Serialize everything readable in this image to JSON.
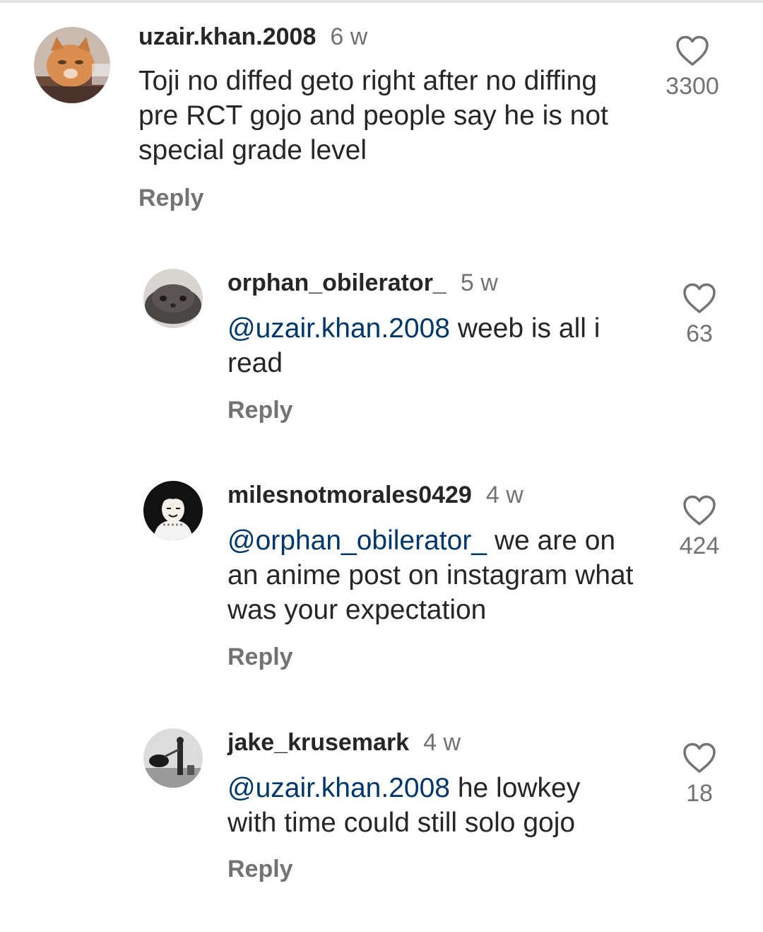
{
  "comments": [
    {
      "username": "uzair.khan.2008",
      "time": "6 w",
      "mention": "",
      "text": "Toji no diffed geto right after no diffing pre RCT gojo and people say he is not special grade level",
      "reply_label": "Reply",
      "likes": "3300",
      "avatar_icon": "cat-avatar",
      "is_reply": false
    },
    {
      "username": "orphan_obilerator_",
      "time": "5 w",
      "mention": "@uzair.khan.2008",
      "text": " weeb is all i read",
      "reply_label": "Reply",
      "likes": "63",
      "avatar_icon": "grey-cat-avatar",
      "is_reply": true
    },
    {
      "username": "milesnotmorales0429",
      "time": "4 w",
      "mention": "@orphan_obilerator_",
      "text": " we are on an anime post on instagram what was your expectation",
      "reply_label": "Reply",
      "likes": "424",
      "avatar_icon": "anime-character-avatar",
      "is_reply": true
    },
    {
      "username": "jake_krusemark",
      "time": "4 w",
      "mention": "@uzair.khan.2008",
      "text": " he lowkey with time could still solo gojo",
      "reply_label": "Reply",
      "likes": "18",
      "avatar_icon": "bw-photo-avatar",
      "is_reply": true
    }
  ],
  "colors": {
    "text": "#262626",
    "secondary": "#737373",
    "mention": "#00376b",
    "background": "#ffffff"
  }
}
